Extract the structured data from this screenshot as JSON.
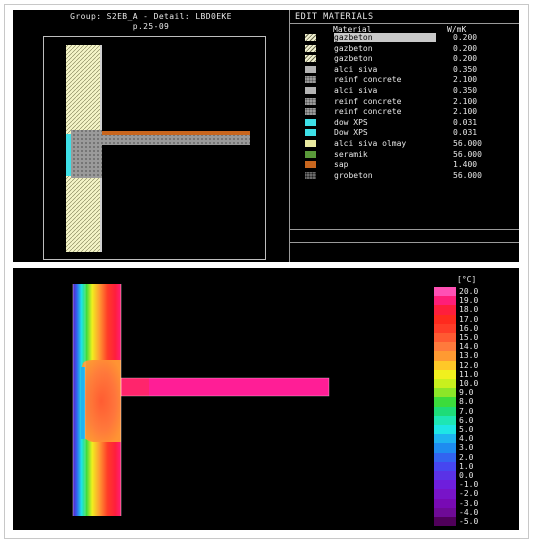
{
  "geometry_panel": {
    "header_line1": "Group: S2EB_A - Detail: LBD0EKE",
    "header_line2": "p.25-09"
  },
  "materials_panel": {
    "title": "EDIT MATERIALS",
    "col_material": "Material",
    "col_unit": "W/mK",
    "selected_index": 0,
    "rows": [
      {
        "name": "gazbeton",
        "value": "0.200",
        "swatch": "hatch-light"
      },
      {
        "name": "gazbeton",
        "value": "0.200",
        "swatch": "hatch-light"
      },
      {
        "name": "gazbeton",
        "value": "0.200",
        "swatch": "hatch-light"
      },
      {
        "name": "alci siva",
        "value": "0.350",
        "swatch": "#b4b4b4"
      },
      {
        "name": "reinf concrete",
        "value": "2.100",
        "swatch": "dots-grey"
      },
      {
        "name": "alci siva",
        "value": "0.350",
        "swatch": "#b4b4b4"
      },
      {
        "name": "reinf concrete",
        "value": "2.100",
        "swatch": "dots-grey"
      },
      {
        "name": "reinf concrete",
        "value": "2.100",
        "swatch": "dots-grey"
      },
      {
        "name": "dow XPS",
        "value": "0.031",
        "swatch": "#3ee0e8"
      },
      {
        "name": "Dow XPS",
        "value": "0.031",
        "swatch": "#3ee0e8"
      },
      {
        "name": "alci siva olmay",
        "value": "56.000",
        "swatch": "#eaeaa0"
      },
      {
        "name": "seramik",
        "value": "56.000",
        "swatch": "#5a9a3a"
      },
      {
        "name": "sap",
        "value": "1.400",
        "swatch": "#c8661e"
      },
      {
        "name": "grobeton",
        "value": "56.000",
        "swatch": "dots-dark"
      }
    ]
  },
  "temperature_legend": {
    "unit": "[°C]",
    "entries": [
      {
        "label": "20.0",
        "color": "#ff50b4"
      },
      {
        "label": "19.0",
        "color": "#ff1e78"
      },
      {
        "label": "18.0",
        "color": "#ff1e3c"
      },
      {
        "label": "17.0",
        "color": "#ff2a1e"
      },
      {
        "label": "16.0",
        "color": "#ff3c28"
      },
      {
        "label": "15.0",
        "color": "#ff5a32"
      },
      {
        "label": "14.0",
        "color": "#ff7a3c"
      },
      {
        "label": "13.0",
        "color": "#ff9a32"
      },
      {
        "label": "12.0",
        "color": "#ffc828"
      },
      {
        "label": "11.0",
        "color": "#f0f01e"
      },
      {
        "label": "10.0",
        "color": "#c8f01e"
      },
      {
        "label": "9.0",
        "color": "#8ce628"
      },
      {
        "label": "8.0",
        "color": "#3cdc3c"
      },
      {
        "label": "7.0",
        "color": "#1edc78"
      },
      {
        "label": "6.0",
        "color": "#1ee6b4"
      },
      {
        "label": "5.0",
        "color": "#1ee6e6"
      },
      {
        "label": "4.0",
        "color": "#1eb4f0"
      },
      {
        "label": "3.0",
        "color": "#1e8cf0"
      },
      {
        "label": "2.0",
        "color": "#3264f0"
      },
      {
        "label": "1.0",
        "color": "#4646f0"
      },
      {
        "label": "0.0",
        "color": "#5a32e6"
      },
      {
        "label": "-1.0",
        "color": "#6e1edc"
      },
      {
        "label": "-2.0",
        "color": "#7814c8"
      },
      {
        "label": "-3.0",
        "color": "#780ab4"
      },
      {
        "label": "-4.0",
        "color": "#6e0a96"
      },
      {
        "label": "-5.0",
        "color": "#50005a"
      }
    ]
  }
}
